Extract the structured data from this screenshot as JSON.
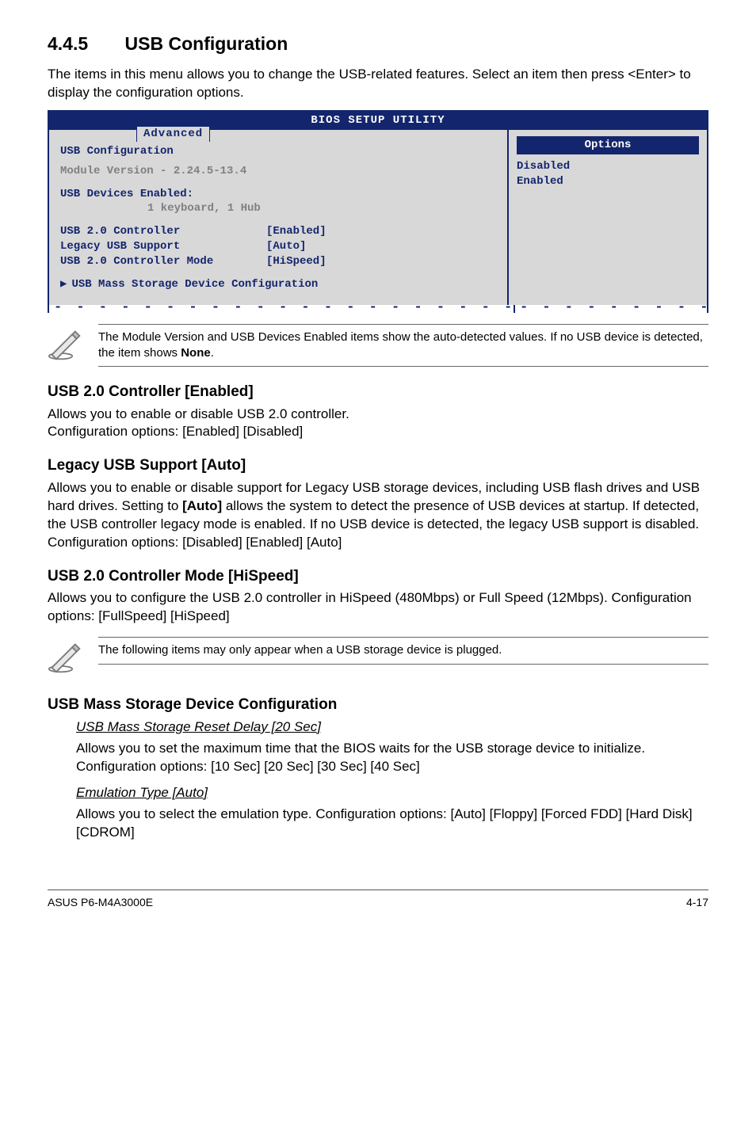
{
  "section": {
    "number": "4.4.5",
    "title": "USB Configuration"
  },
  "intro": "The items in this menu allows you to change the USB-related features. Select an item then press <Enter> to display the configuration options.",
  "bios": {
    "header": "BIOS SETUP UTILITY",
    "tab": "Advanced",
    "panel_title": "USB Configuration",
    "module_version": "Module Version - 2.24.5-13.4",
    "devices_label": "USB Devices Enabled:",
    "devices_value": "1 keyboard, 1 Hub",
    "rows": [
      {
        "label": "USB 2.0 Controller",
        "value": "[Enabled]"
      },
      {
        "label": "Legacy USB Support",
        "value": "[Auto]"
      },
      {
        "label": "USB 2.0 Controller Mode",
        "value": "[HiSpeed]"
      }
    ],
    "submenu": "USB Mass Storage Device Configuration",
    "options_title": "Options",
    "options": [
      "Disabled",
      "Enabled"
    ]
  },
  "note1": "The Module Version and USB Devices Enabled items show the auto-detected values. If no USB device is detected, the item shows ",
  "note1_bold": "None",
  "note1_tail": ".",
  "items": {
    "a": {
      "title": "USB 2.0 Controller [Enabled]",
      "line1": "Allows you to enable or disable USB 2.0 controller.",
      "line2": "Configuration options: [Enabled] [Disabled]"
    },
    "b": {
      "title": "Legacy USB Support [Auto]",
      "body": "Allows you to enable or disable support for Legacy USB storage devices, including USB flash drives and USB hard drives. Setting to [Auto] allows the system to detect the presence of USB devices at startup. If detected, the USB controller legacy mode is enabled. If no USB device is detected, the legacy USB support is disabled. Configuration options: [Disabled] [Enabled] [Auto]",
      "bold_token": "[Auto]"
    },
    "c": {
      "title": "USB 2.0 Controller Mode [HiSpeed]",
      "body": "Allows you to configure the USB 2.0 controller in HiSpeed (480Mbps) or Full Speed (12Mbps). Configuration options: [FullSpeed] [HiSpeed]"
    }
  },
  "note2": "The following items may only appear when a USB storage device is plugged.",
  "mass": {
    "title": "USB Mass Storage Device Configuration",
    "a_head": "USB Mass Storage Reset Delay [20 Sec]",
    "a_body": "Allows you to set the maximum time that the BIOS waits for the USB storage device to initialize. Configuration options: [10 Sec] [20 Sec] [30 Sec] [40 Sec]",
    "b_head": "Emulation Type [Auto]",
    "b_body": "Allows you to select the emulation type. Configuration options: [Auto] [Floppy] [Forced FDD] [Hard Disk] [CDROM]"
  },
  "footer": {
    "left": "ASUS P6-M4A3000E",
    "right": "4-17"
  }
}
